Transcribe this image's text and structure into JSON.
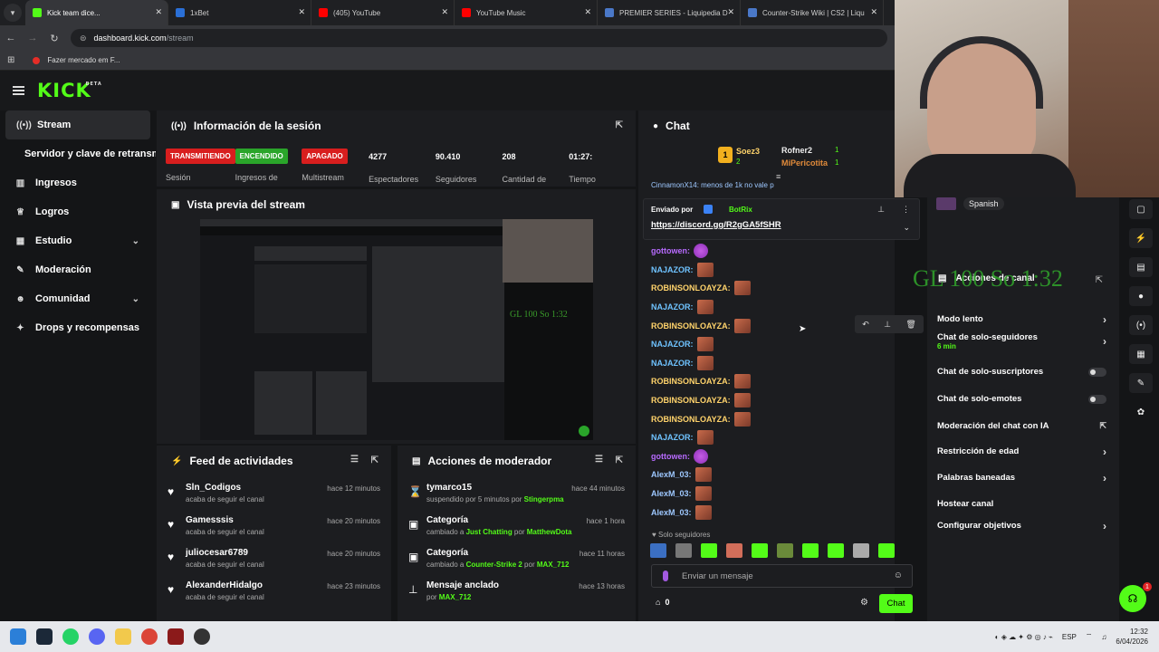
{
  "browser": {
    "tabs": [
      {
        "label": "Kick team dice...",
        "color": "#53fc18",
        "active": true
      },
      {
        "label": "1xBet",
        "color": "#2a6fd6"
      },
      {
        "label": "(405) YouTube",
        "color": "#ff0000"
      },
      {
        "label": "YouTube Music",
        "color": "#ff0000"
      },
      {
        "label": "PREMIER SERIES - Liquipedia D",
        "color": "#4a78c8"
      },
      {
        "label": "Counter-Strike Wiki | CS2 | Liqu",
        "color": "#4a78c8"
      }
    ],
    "url_host": "dashboard.kick.com",
    "url_path": "/stream",
    "bookmark": "Fazer mercado em F..."
  },
  "app": {
    "logo": "KICK",
    "logo_beta": "BETA"
  },
  "sidebar": {
    "items": [
      {
        "label": "Stream",
        "icon": "broadcast-icon"
      },
      {
        "label": "Servidor y clave de retransmi",
        "icon": ""
      },
      {
        "label": "Ingresos",
        "icon": "bank-icon"
      },
      {
        "label": "Logros",
        "icon": "trophy-icon"
      },
      {
        "label": "Estudio",
        "icon": "layout-icon"
      },
      {
        "label": "Moderación",
        "icon": "wrench-icon"
      },
      {
        "label": "Comunidad",
        "icon": "users-icon"
      },
      {
        "label": "Drops y recompensas",
        "icon": "gift-icon"
      }
    ]
  },
  "session": {
    "title": "Información de la sesión",
    "stats": [
      {
        "badge": "TRANSMITIENDO",
        "label": "Sesión",
        "color": "#d81e1e"
      },
      {
        "badge": "ENCENDIDO",
        "label": "Ingresos de",
        "color": "#2aa52a"
      },
      {
        "badge": "APAGADO",
        "label": "Multistream",
        "color": "#d81e1e"
      },
      {
        "value": "4277",
        "label": "Espectadores"
      },
      {
        "value": "90.410",
        "label": "Seguidores"
      },
      {
        "value": "208",
        "label": "Cantidad de"
      },
      {
        "value": "01:27:",
        "label": "Tiempo"
      }
    ]
  },
  "preview": {
    "title": "Vista previa del stream"
  },
  "feed": {
    "title": "Feed de actividades",
    "items": [
      {
        "user": "Sln_Codigos",
        "sub": "acaba de seguir el canal",
        "time": "hace 12 minutos"
      },
      {
        "user": "Gamesssis",
        "sub": "acaba de seguir el canal",
        "time": "hace 20 minutos"
      },
      {
        "user": "juliocesar6789",
        "sub": "acaba de seguir el canal",
        "time": "hace 20 minutos"
      },
      {
        "user": "AlexanderHidalgo",
        "sub": "acaba de seguir el canal",
        "time": "hace 23 minutos"
      }
    ]
  },
  "modactions": {
    "title": "Acciones de moderador",
    "items": [
      {
        "title": "tymarco15",
        "pre": "suspendido por 5 minutos por ",
        "highlight": "Stingerpma",
        "mid": "",
        "highlight2": "",
        "time": "hace 44 minutos"
      },
      {
        "title": "Categoría",
        "pre": "cambiado a ",
        "highlight": "Just Chatting",
        "mid": " por ",
        "highlight2": "MatthewDota",
        "time": "hace 1 hora"
      },
      {
        "title": "Categoría",
        "pre": "cambiado a ",
        "highlight": "Counter-Strike 2",
        "mid": " por ",
        "highlight2": "MAX_712",
        "time": "hace 11 horas"
      },
      {
        "title": "Mensaje anclado",
        "pre": "por ",
        "highlight": "MAX_712",
        "mid": "",
        "highlight2": "",
        "time": "hace 13 horas"
      }
    ]
  },
  "chat": {
    "title": "Chat",
    "leaders": [
      {
        "name": "Soez3",
        "rank": "1",
        "count": "2"
      },
      {
        "name": "Rofner2",
        "count": "1"
      },
      {
        "name": "MiPericotita",
        "count": "1"
      }
    ],
    "partial_line": "CinnamonX14: menos de 1k no vale p",
    "pinned": {
      "sent_by": "Enviado por",
      "bot": "BotRix",
      "link": "https://discord.gg/R2gGA5fSHR"
    },
    "messages": [
      {
        "user": "gottowen:",
        "color": "#b86bff",
        "emote": "purple"
      },
      {
        "user": "NAJAZOR:",
        "color": "#6fc3ff",
        "emote": "red"
      },
      {
        "user": "ROBINSONLOAYZA:",
        "color": "#ffd36b",
        "emote": "red"
      },
      {
        "user": "NAJAZOR:",
        "color": "#6fc3ff",
        "emote": "red"
      },
      {
        "user": "ROBINSONLOAYZA:",
        "color": "#ffd36b",
        "emote": "red"
      },
      {
        "user": "NAJAZOR:",
        "color": "#6fc3ff",
        "emote": "red"
      },
      {
        "user": "NAJAZOR:",
        "color": "#6fc3ff",
        "emote": "red"
      },
      {
        "user": "ROBINSONLOAYZA:",
        "color": "#ffd36b",
        "emote": "red"
      },
      {
        "user": "ROBINSONLOAYZA:",
        "color": "#ffd36b",
        "emote": "red"
      },
      {
        "user": "ROBINSONLOAYZA:",
        "color": "#ffd36b",
        "emote": "red"
      },
      {
        "user": "NAJAZOR:",
        "color": "#6fc3ff",
        "emote": "red"
      },
      {
        "user": "gottowen:",
        "color": "#b86bff",
        "emote": "purple"
      },
      {
        "user": "AlexM_03:",
        "color": "#9ec8ff",
        "emote": "red"
      },
      {
        "user": "AlexM_03:",
        "color": "#9ec8ff",
        "emote": "red"
      },
      {
        "user": "AlexM_03:",
        "color": "#9ec8ff",
        "emote": "red"
      }
    ],
    "mode_label": "Solo seguidores",
    "input_placeholder": "Enviar un mensaje",
    "points": "0",
    "send_label": "Chat"
  },
  "overlay": {
    "text": "GL 100 So 1:32",
    "language": "Spanish"
  },
  "mod_panel": {
    "title": "Acciones de canal",
    "rows": [
      {
        "label": "Modo lento",
        "control": "chevron"
      },
      {
        "label": "Chat de solo-seguidores",
        "sub": "6 min",
        "control": "chevron"
      },
      {
        "label": "Chat de solo-suscriptores",
        "control": "toggle"
      },
      {
        "label": "Chat de solo-emotes",
        "control": "toggle"
      },
      {
        "label": "Moderación del chat con IA",
        "control": "external"
      },
      {
        "label": "Restricción de edad",
        "control": "chevron"
      },
      {
        "label": "Palabras baneadas",
        "control": "chevron"
      },
      {
        "label": "Hostear canal",
        "control": "none"
      },
      {
        "label": "Configurar objetivos",
        "control": "chevron"
      }
    ]
  },
  "taskbar": {
    "lang": "ESP",
    "time": "12:32",
    "date": "6/04/2026",
    "support_badge": "1"
  },
  "colors": {
    "accent": "#53fc18",
    "bg": "#141517",
    "panel": "#1c1d20"
  }
}
